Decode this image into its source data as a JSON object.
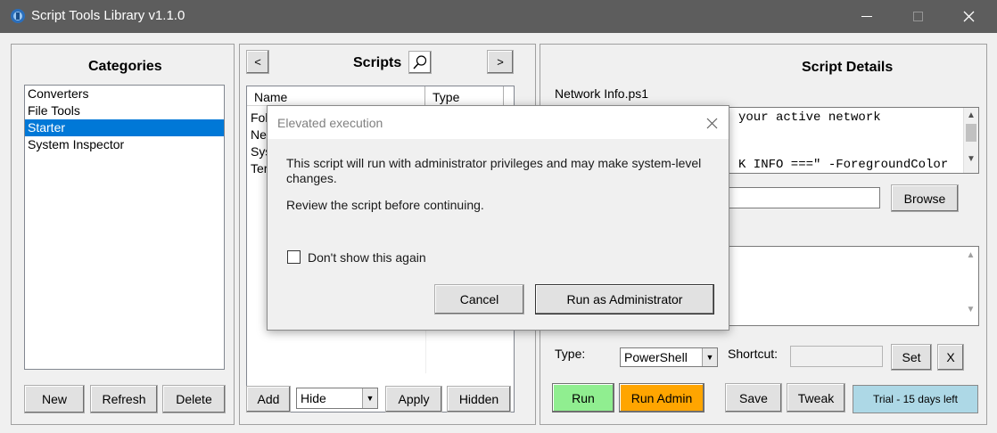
{
  "window": {
    "title": "Script Tools Library v1.1.0",
    "minimize": "–",
    "close": "✕"
  },
  "categories": {
    "heading": "Categories",
    "items": [
      "Converters",
      "File Tools",
      "Starter",
      "System Inspector"
    ],
    "buttons": {
      "new": "New",
      "refresh": "Refresh",
      "delete": "Delete"
    }
  },
  "scripts": {
    "heading": "Scripts",
    "prev": "<",
    "next": ">",
    "columns": {
      "name": "Name",
      "type": "Type"
    },
    "rows": [
      "Fol",
      "Ne",
      "Sys",
      "Ter"
    ],
    "buttons": {
      "add": "Add",
      "apply": "Apply",
      "hidden": "Hidden"
    },
    "filter": "Hide"
  },
  "details": {
    "heading": "Script Details",
    "filename": "Network Info.ps1",
    "code_line1": "your active network",
    "code_line2": "K INFO ===\" -ForegroundColor",
    "browse": "Browse",
    "type_label": "Type:",
    "type_value": "PowerShell",
    "shortcut_label": "Shortcut:",
    "set": "Set",
    "clear": "X",
    "run": "Run",
    "run_admin": "Run Admin",
    "save": "Save",
    "tweak": "Tweak",
    "trial": "Trial - 15 days left"
  },
  "dialog": {
    "title": "Elevated execution",
    "message1": "This script will run with administrator privileges and may make system-level",
    "message1b": "changes.",
    "message2": "Review the script before continuing.",
    "checkbox": "Don't show this again",
    "cancel": "Cancel",
    "confirm": "Run as Administrator"
  },
  "colors": {
    "titlebar": "#5d5d5d",
    "selection": "#0078d7",
    "run": "#90ee90",
    "run_admin": "#ffa500",
    "trial": "#add8e6"
  }
}
